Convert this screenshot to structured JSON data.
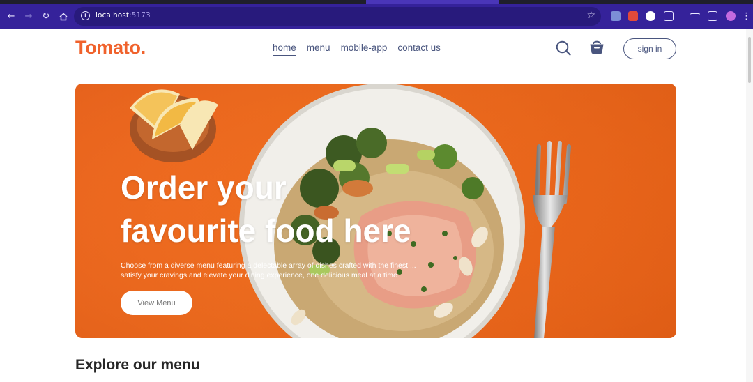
{
  "browser": {
    "url_host": "localhost",
    "url_port": ":5173",
    "icons": [
      "back-arrow-icon",
      "forward-arrow-icon",
      "reload-icon",
      "home-icon",
      "site-info-icon",
      "bookmark-star-icon"
    ]
  },
  "nav": {
    "logo": "Tomato.",
    "links": [
      {
        "label": "home",
        "active": true
      },
      {
        "label": "menu",
        "active": false
      },
      {
        "label": "mobile-app",
        "active": false
      },
      {
        "label": "contact us",
        "active": false
      }
    ],
    "signin_label": "sign in"
  },
  "hero": {
    "title_line1": "Order your",
    "title_line2": "favourite food here",
    "description": "Choose from a diverse menu featuring a delectable array of dishes crafted with the finest ... satisfy your cravings and elevate your dining experience, one delicious meal at a time.",
    "cta_label": "View Menu"
  },
  "explore": {
    "heading": "Explore our menu"
  },
  "colors": {
    "brand": "#f0622c",
    "nav_text": "#49557e",
    "hero_bg": "#ee6c1e",
    "chrome_bg": "#35229a"
  }
}
